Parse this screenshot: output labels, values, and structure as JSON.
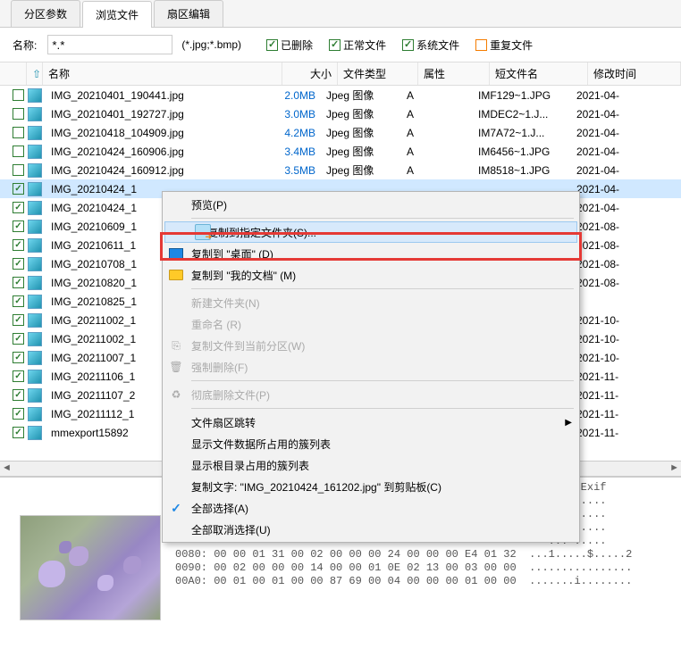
{
  "tabs": [
    "分区参数",
    "浏览文件",
    "扇区编辑"
  ],
  "activeTab": 1,
  "filter": {
    "label": "名称:",
    "value": "*.*",
    "ext": "(*.jpg;*.bmp)",
    "checks": [
      {
        "label": "已删除",
        "checked": true,
        "color": "green"
      },
      {
        "label": "正常文件",
        "checked": true,
        "color": "green"
      },
      {
        "label": "系统文件",
        "checked": true,
        "color": "green"
      },
      {
        "label": "重复文件",
        "checked": false,
        "color": "orange"
      }
    ]
  },
  "columns": [
    "名称",
    "大小",
    "文件类型",
    "属性",
    "短文件名",
    "修改时间"
  ],
  "rows": [
    {
      "chk": false,
      "name": "IMG_20210401_190441.jpg",
      "size": "2.0MB",
      "type": "Jpeg 图像",
      "attr": "A",
      "short": "IMF129~1.JPG",
      "date": "2021-04-",
      "sel": false
    },
    {
      "chk": false,
      "name": "IMG_20210401_192727.jpg",
      "size": "3.0MB",
      "type": "Jpeg 图像",
      "attr": "A",
      "short": "IMDEC2~1.J...",
      "date": "2021-04-",
      "sel": false
    },
    {
      "chk": false,
      "name": "IMG_20210418_104909.jpg",
      "size": "4.2MB",
      "type": "Jpeg 图像",
      "attr": "A",
      "short": "IM7A72~1.J...",
      "date": "2021-04-",
      "sel": false
    },
    {
      "chk": false,
      "name": "IMG_20210424_160906.jpg",
      "size": "3.4MB",
      "type": "Jpeg 图像",
      "attr": "A",
      "short": "IM6456~1.JPG",
      "date": "2021-04-",
      "sel": false
    },
    {
      "chk": false,
      "name": "IMG_20210424_160912.jpg",
      "size": "3.5MB",
      "type": "Jpeg 图像",
      "attr": "A",
      "short": "IM8518~1.JPG",
      "date": "2021-04-",
      "sel": false
    },
    {
      "chk": true,
      "name": "IMG_20210424_1",
      "size": "",
      "type": "",
      "attr": "",
      "short": "",
      "date": "2021-04-",
      "sel": true
    },
    {
      "chk": true,
      "name": "IMG_20210424_1",
      "size": "",
      "type": "",
      "attr": "",
      "short": "",
      "date": "2021-04-",
      "sel": false
    },
    {
      "chk": true,
      "name": "IMG_20210609_1",
      "size": "",
      "type": "",
      "attr": "",
      "short": "",
      "date": "2021-08-",
      "sel": false
    },
    {
      "chk": true,
      "name": "IMG_20210611_1",
      "size": "",
      "type": "",
      "attr": "",
      "short": "",
      "date": "2021-08-",
      "sel": false
    },
    {
      "chk": true,
      "name": "IMG_20210708_1",
      "size": "",
      "type": "",
      "attr": "",
      "short": "",
      "date": "2021-08-",
      "sel": false
    },
    {
      "chk": true,
      "name": "IMG_20210820_1",
      "size": "",
      "type": "",
      "attr": "",
      "short": "",
      "date": "2021-08-",
      "sel": false
    },
    {
      "chk": true,
      "name": "IMG_20210825_1",
      "size": "",
      "type": "",
      "attr": "",
      "short": "",
      "date": "",
      "sel": false
    },
    {
      "chk": true,
      "name": "IMG_20211002_1",
      "size": "",
      "type": "",
      "attr": "",
      "short": "",
      "date": "2021-10-",
      "sel": false
    },
    {
      "chk": true,
      "name": "IMG_20211002_1",
      "size": "",
      "type": "",
      "attr": "",
      "short": "",
      "date": "2021-10-",
      "sel": false
    },
    {
      "chk": true,
      "name": "IMG_20211007_1",
      "size": "",
      "type": "",
      "attr": "",
      "short": "",
      "date": "2021-10-",
      "sel": false
    },
    {
      "chk": true,
      "name": "IMG_20211106_1",
      "size": "",
      "type": "",
      "attr": "",
      "short": "",
      "date": "2021-11-",
      "sel": false
    },
    {
      "chk": true,
      "name": "IMG_20211107_2",
      "size": "",
      "type": "",
      "attr": "",
      "short": "",
      "date": "2021-11-",
      "sel": false
    },
    {
      "chk": true,
      "name": "IMG_20211112_1",
      "size": "",
      "type": "",
      "attr": "",
      "short": "",
      "date": "2021-11-",
      "sel": false
    },
    {
      "chk": true,
      "name": "mmexport15892",
      "size": "",
      "type": "",
      "attr": "",
      "short": "",
      "date": "2021-11-",
      "sel": false
    }
  ],
  "contextMenu": [
    {
      "label": "预览(P)",
      "type": "item"
    },
    {
      "type": "sep"
    },
    {
      "label": "复制到指定文件夹(S)...",
      "type": "item",
      "icon": "copy",
      "highlighted": true
    },
    {
      "label": "复制到 \"桌面\"  (D)",
      "type": "item",
      "icon": "desktop"
    },
    {
      "label": "复制到 \"我的文档\"  (M)",
      "type": "item",
      "icon": "folder"
    },
    {
      "type": "sep"
    },
    {
      "label": "新建文件夹(N)",
      "type": "item",
      "disabled": true
    },
    {
      "label": "重命名 (R)",
      "type": "item",
      "disabled": true
    },
    {
      "label": "复制文件到当前分区(W)",
      "type": "item",
      "icon": "copyw",
      "disabled": true
    },
    {
      "label": "强制删除(F)",
      "type": "item",
      "icon": "trash",
      "disabled": true
    },
    {
      "type": "sep"
    },
    {
      "label": "彻底删除文件(P)",
      "type": "item",
      "icon": "recycle",
      "disabled": true
    },
    {
      "type": "sep"
    },
    {
      "label": "文件扇区跳转",
      "type": "item",
      "arrow": true
    },
    {
      "label": "显示文件数据所占用的簇列表",
      "type": "item"
    },
    {
      "label": "显示根目录占用的簇列表",
      "type": "item"
    },
    {
      "label": "复制文字: \"IMG_20210424_161202.jpg\" 到剪贴板(C)",
      "type": "item"
    },
    {
      "label": "全部选择(A)",
      "type": "item",
      "icon": "check"
    },
    {
      "label": "全部取消选择(U)",
      "type": "item"
    }
  ],
  "hex": {
    "right1": ". d. Exif",
    "right2": ".........",
    "right3": ".........",
    "right4": ".........",
    "right5": "... .....",
    "line1": "0080: 00 00 01 31 00 02 00 00 00 24 00 00 00 E4 01 32  ...1.....$.....2",
    "line2": "0090: 00 02 00 00 00 14 00 00 01 0E 02 13 00 03 00 00  ................",
    "line3": "00A0: 00 01 00 01 00 00 87 69 00 04 00 00 00 01 00 00  .......i........"
  }
}
